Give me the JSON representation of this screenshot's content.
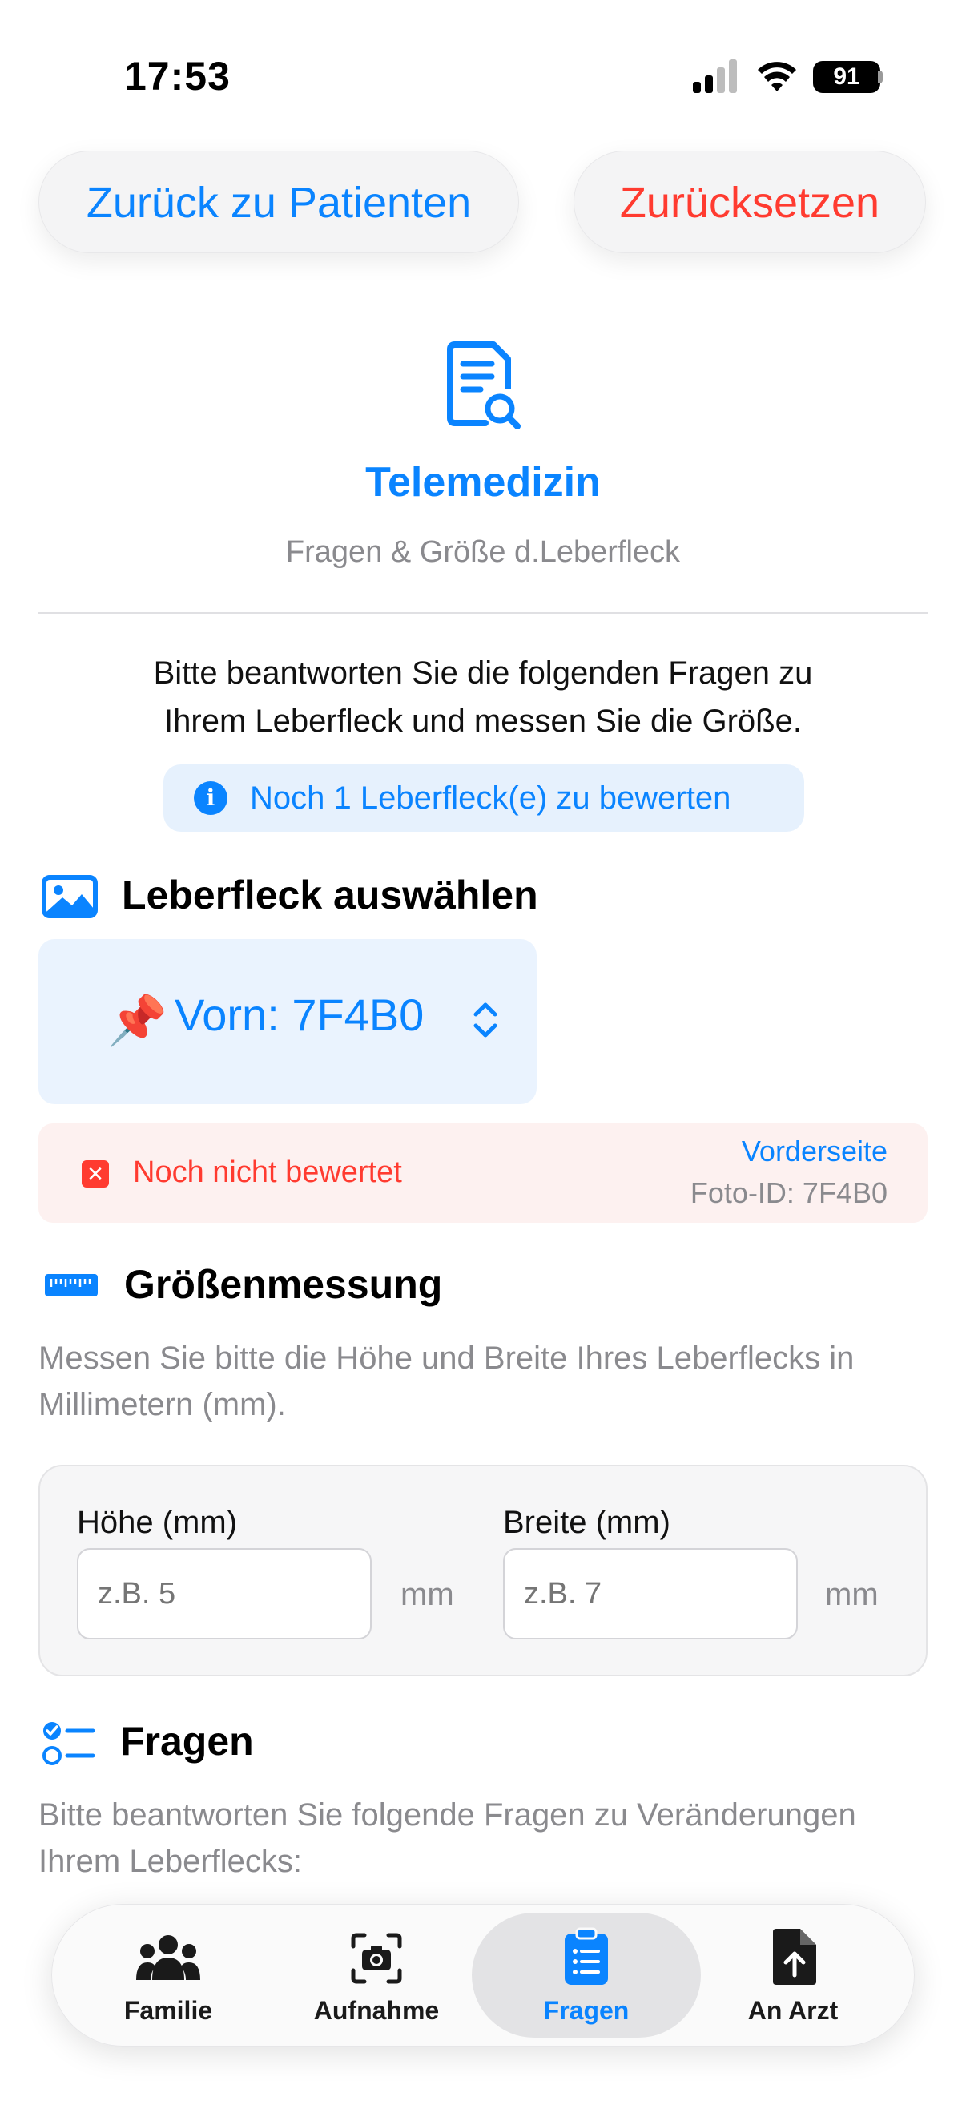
{
  "status_bar": {
    "time": "17:53",
    "battery": "91"
  },
  "top_buttons": {
    "back": "Zurück zu Patienten",
    "reset": "Zurücksetzen"
  },
  "header": {
    "title": "Telemedizin",
    "subtitle": "Fragen & Größe d.Leberfleck",
    "intro_line1": "Bitte beantworten Sie die folgenden Fragen zu",
    "intro_line2": "Ihrem Leberfleck und messen Sie die Größe.",
    "info_badge": "Noch 1 Leberfleck(e) zu bewerten"
  },
  "select_section": {
    "title": "Leberfleck auswählen",
    "picker_emoji": "📌",
    "picker_value": "Vorn: 7F4B0",
    "status_text": "Noch nicht bewertet",
    "side": "Vorderseite",
    "photo_id": "Foto-ID: 7F4B0"
  },
  "measure_section": {
    "title": "Größenmessung",
    "desc_line1": "Messen Sie bitte die Höhe und Breite Ihres Leberflecks in",
    "desc_line2": "Millimetern (mm).",
    "height_label": "Höhe (mm)",
    "height_placeholder": "z.B. 5",
    "width_label": "Breite (mm)",
    "width_placeholder": "z.B. 7",
    "unit": "mm"
  },
  "questions_section": {
    "title": "Fragen",
    "desc_line1": "Bitte beantworten Sie folgende Fragen zu Veränderungen",
    "desc_line2": "Ihrem Leberflecks:"
  },
  "tabbar": {
    "tabs": [
      {
        "label": "Familie",
        "icon": "people-icon"
      },
      {
        "label": "Aufnahme",
        "icon": "camera-icon"
      },
      {
        "label": "Fragen",
        "icon": "clipboard-list-icon",
        "active": true
      },
      {
        "label": "An Arzt",
        "icon": "document-upload-icon"
      }
    ]
  },
  "colors": {
    "accent": "#0a84ff",
    "destructive": "#ff3b30",
    "secondary_text": "#8a8a8e"
  }
}
